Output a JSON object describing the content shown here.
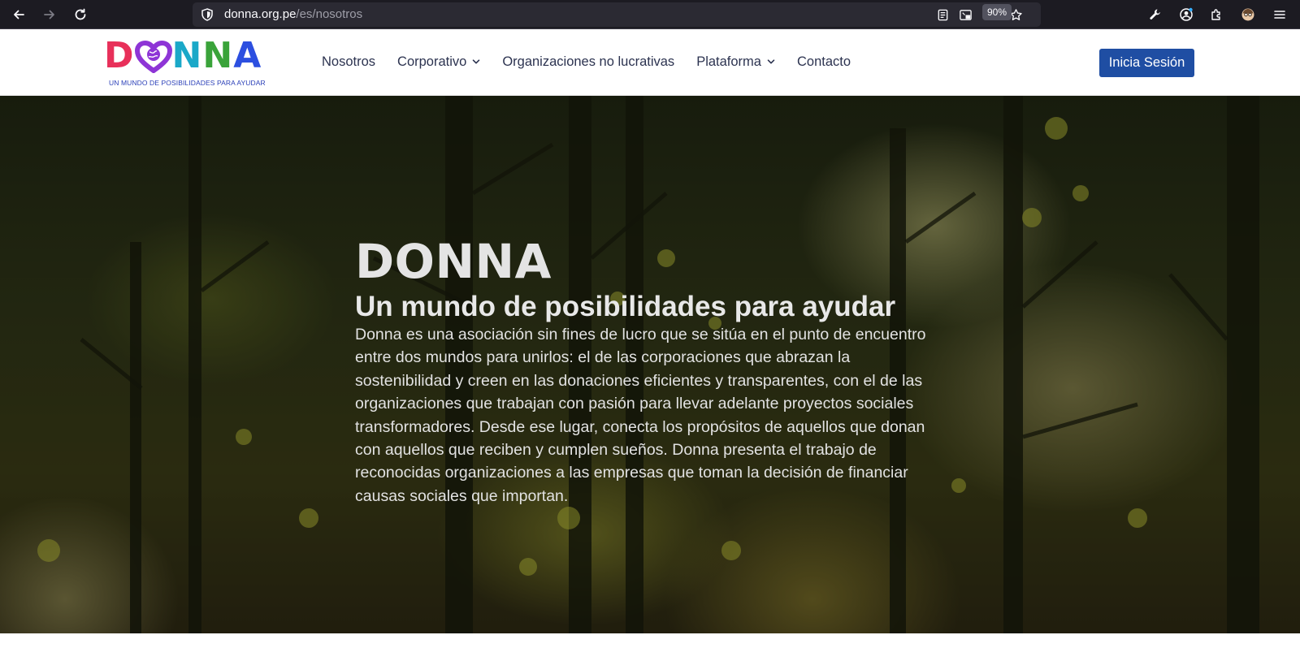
{
  "browser": {
    "url_host": "donna.org.pe",
    "url_path": "/es/nosotros",
    "zoom": "90%"
  },
  "site": {
    "logo_text": "DONNA",
    "logo_tagline": "UN MUNDO DE POSIBILIDADES PARA AYUDAR",
    "nav": [
      {
        "label": "Nosotros"
      },
      {
        "label": "Corporativo"
      },
      {
        "label": "Organizaciones no lucrativas"
      },
      {
        "label": "Plataforma"
      },
      {
        "label": "Contacto"
      }
    ],
    "login_label": "Inicia Sesión"
  },
  "hero": {
    "title": "DONNA",
    "subtitle": "Un mundo de posibilidades para ayudar",
    "body": "Donna es una asociación sin fines de lucro que se sitúa en el punto de encuentro entre dos mundos para unirlos: el de las corporaciones que abrazan la sostenibilidad y creen en las donaciones eficientes y transparentes, con el de las organizaciones que trabajan con pasión para llevar adelante proyectos sociales transformadores. Desde ese lugar, conecta los propósitos de aquellos que donan con aquellos que reciben y cumplen sueños. Donna presenta el trabajo de reconocidas organizaciones a las empresas que toman la decisión de financiar causas sociales que importan."
  },
  "colors": {
    "brand_blue": "#1f4ea3",
    "nav_text": "#2c3350",
    "logo_letters": [
      "#e8305a",
      "#8e35d6",
      "#1aa8c8",
      "#3aa33a",
      "#2c4fe0"
    ]
  }
}
